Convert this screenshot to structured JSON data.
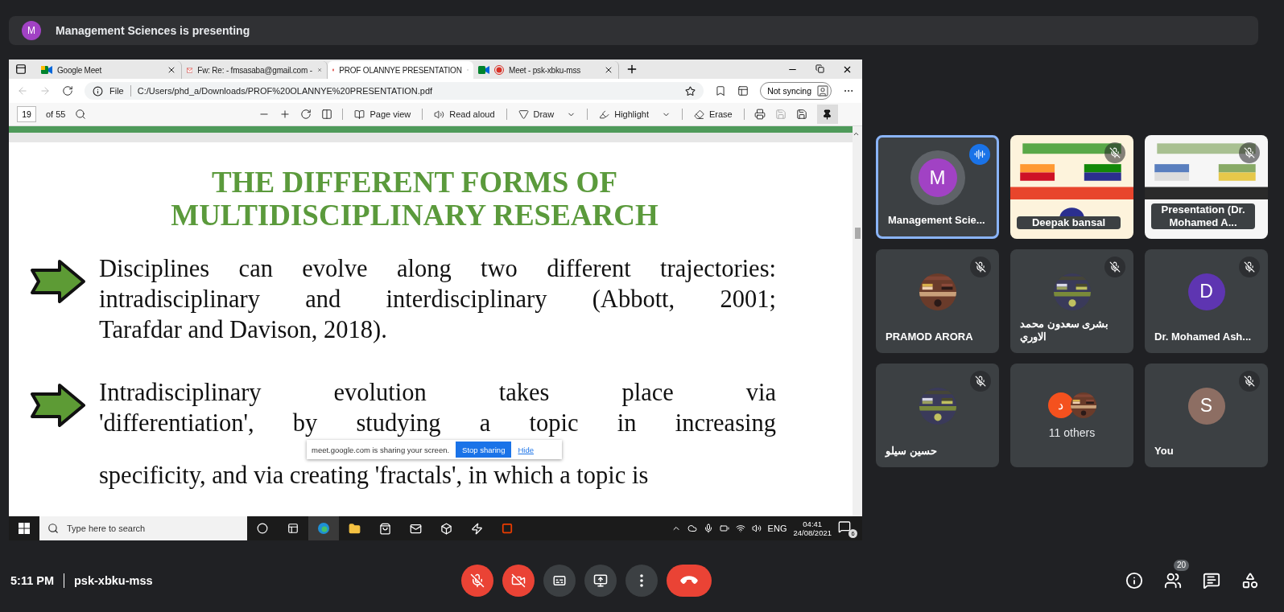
{
  "banner": {
    "avatar": "M",
    "color": "#a142c4",
    "text": "Management Sciences is presenting"
  },
  "browser": {
    "tabs": [
      {
        "title": "Google Meet",
        "selected": false
      },
      {
        "title": "Fw: Re: - fmsasaba@gmail.com -",
        "selected": false
      },
      {
        "title": "PROF OLANNYE PRESENTATION",
        "selected": true
      },
      {
        "title": "Meet - psk-xbku-mss",
        "selected": false
      }
    ],
    "file_label": "File",
    "url": "C:/Users/phd_a/Downloads/PROF%20OLANNYE%20PRESENTATION.pdf",
    "sync_button": "Not syncing"
  },
  "pdf_toolbar": {
    "page": "19",
    "page_count": "of 55",
    "tools": [
      {
        "label": "Page view",
        "menu": false
      },
      {
        "label": "Read aloud",
        "menu": false
      },
      {
        "label": "Draw",
        "menu": true
      },
      {
        "label": "Highlight",
        "menu": true
      },
      {
        "label": "Erase",
        "menu": false
      }
    ]
  },
  "slide": {
    "title_lines": [
      "THE DIFFERENT FORMS OF",
      "MULTIDISCIPLINARY RESEARCH"
    ],
    "bullets": [
      {
        "lines": [
          "Disciplines can evolve along two different trajectories:",
          "intradisciplinary and interdisciplinary (Abbott, 2001;",
          "Tarafdar and Davison, 2018)."
        ]
      },
      {
        "lines": [
          "Intradisciplinary evolution takes place via",
          "'differentiation', by studying a topic in increasing",
          "specificity, and via creating 'fractals', in which a topic is"
        ]
      }
    ]
  },
  "share_notice": {
    "text": "meet.google.com is sharing your screen.",
    "stop": "Stop sharing",
    "hide": "Hide"
  },
  "taskbar": {
    "search_placeholder": "Type here to search",
    "language": "ENG",
    "time": "04:41",
    "date": "24/08/2021",
    "notifications": "6"
  },
  "tiles": [
    {
      "kind": "avatar",
      "name": "Management Scie...",
      "avatar": "M",
      "color": "#a142c4",
      "muted": false,
      "speaking": true
    },
    {
      "kind": "video",
      "name": "Deepak bansal",
      "muted": true,
      "speaking": false
    },
    {
      "kind": "video",
      "name": "Presentation (Dr. Mohamed A...",
      "muted": true,
      "speaking": false
    },
    {
      "name": "PRAMOD ARORA",
      "muted": true,
      "speaking": false
    },
    {
      "name": "بشرى سعدون محمد الاوري",
      "muted": true,
      "speaking": false
    },
    {
      "kind": "avatar",
      "name": "Dr. Mohamed Ash...",
      "avatar": "D",
      "color": "#5e35b1",
      "muted": true,
      "speaking": false
    },
    {
      "name": "حسين سيلو",
      "muted": true,
      "speaking": false
    },
    {
      "kind": "group",
      "name": "11 others",
      "avatar": "د",
      "color": "#f4511e",
      "muted": false,
      "speaking": false
    },
    {
      "kind": "avatar",
      "name": "You",
      "avatar": "S",
      "color": "#8d6e63",
      "muted": true,
      "speaking": false
    }
  ],
  "meeting": {
    "time": "5:11 PM",
    "code": "psk-xbku-mss",
    "mic_on": false,
    "camera_on": false,
    "people_count": "20"
  }
}
